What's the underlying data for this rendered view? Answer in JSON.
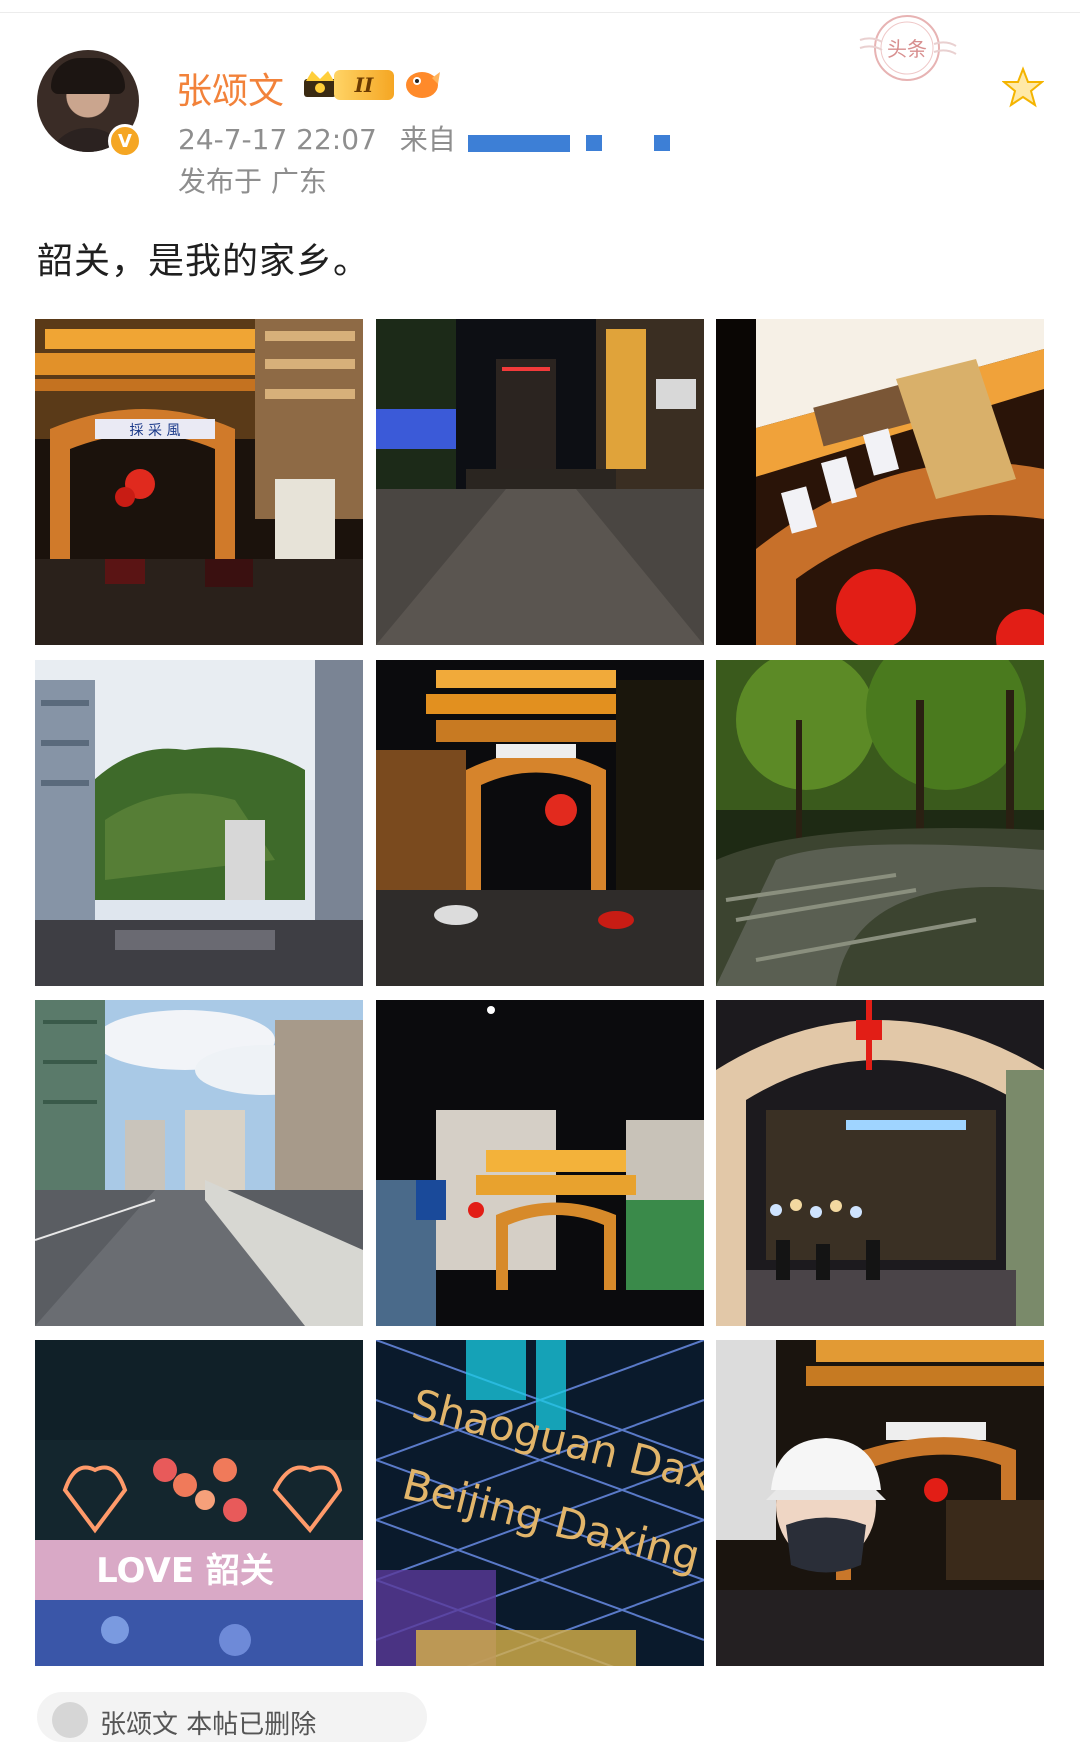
{
  "post": {
    "username": "张颂文",
    "verified_badge": "V",
    "member_level": "II",
    "timestamp": "24-7-17 22:07",
    "source_prefix": "来自",
    "location": "发布于 广东",
    "text": "韶关，是我的家乡。",
    "stamp_label": "头条",
    "images": [
      {
        "alt": "Lit archway gate at night with red lanterns and street traffic"
      },
      {
        "alt": "Night pedestrian street with shops and tall building"
      },
      {
        "alt": "Close-up of archway sign with red lantern"
      },
      {
        "alt": "City skyline with green mountain and traffic"
      },
      {
        "alt": "Archway gate at night with scooters on road"
      },
      {
        "alt": "Tree-lined road with dappled shadows"
      },
      {
        "alt": "Urban road with buildings under blue sky"
      },
      {
        "alt": "Lit gate with traffic lights at night, moon above"
      },
      {
        "alt": "Illuminated arch entrance with crowd and red knot"
      },
      {
        "alt": "I LOVE 韶关 light sign with heart decorations"
      },
      {
        "alt": "Neon sign reading Shaoguan Daxia Beijing Daxing"
      },
      {
        "alt": "Selfie in cap and mask in front of lit archway"
      }
    ],
    "sign_text": {
      "gate": "採 采 風",
      "love": "LOVE 韶关",
      "neon_line1": "Shaoguan Daxia",
      "neon_line2": "Beijing Daxing"
    }
  },
  "comment": {
    "preview": "张颂文 本帖已删除"
  }
}
